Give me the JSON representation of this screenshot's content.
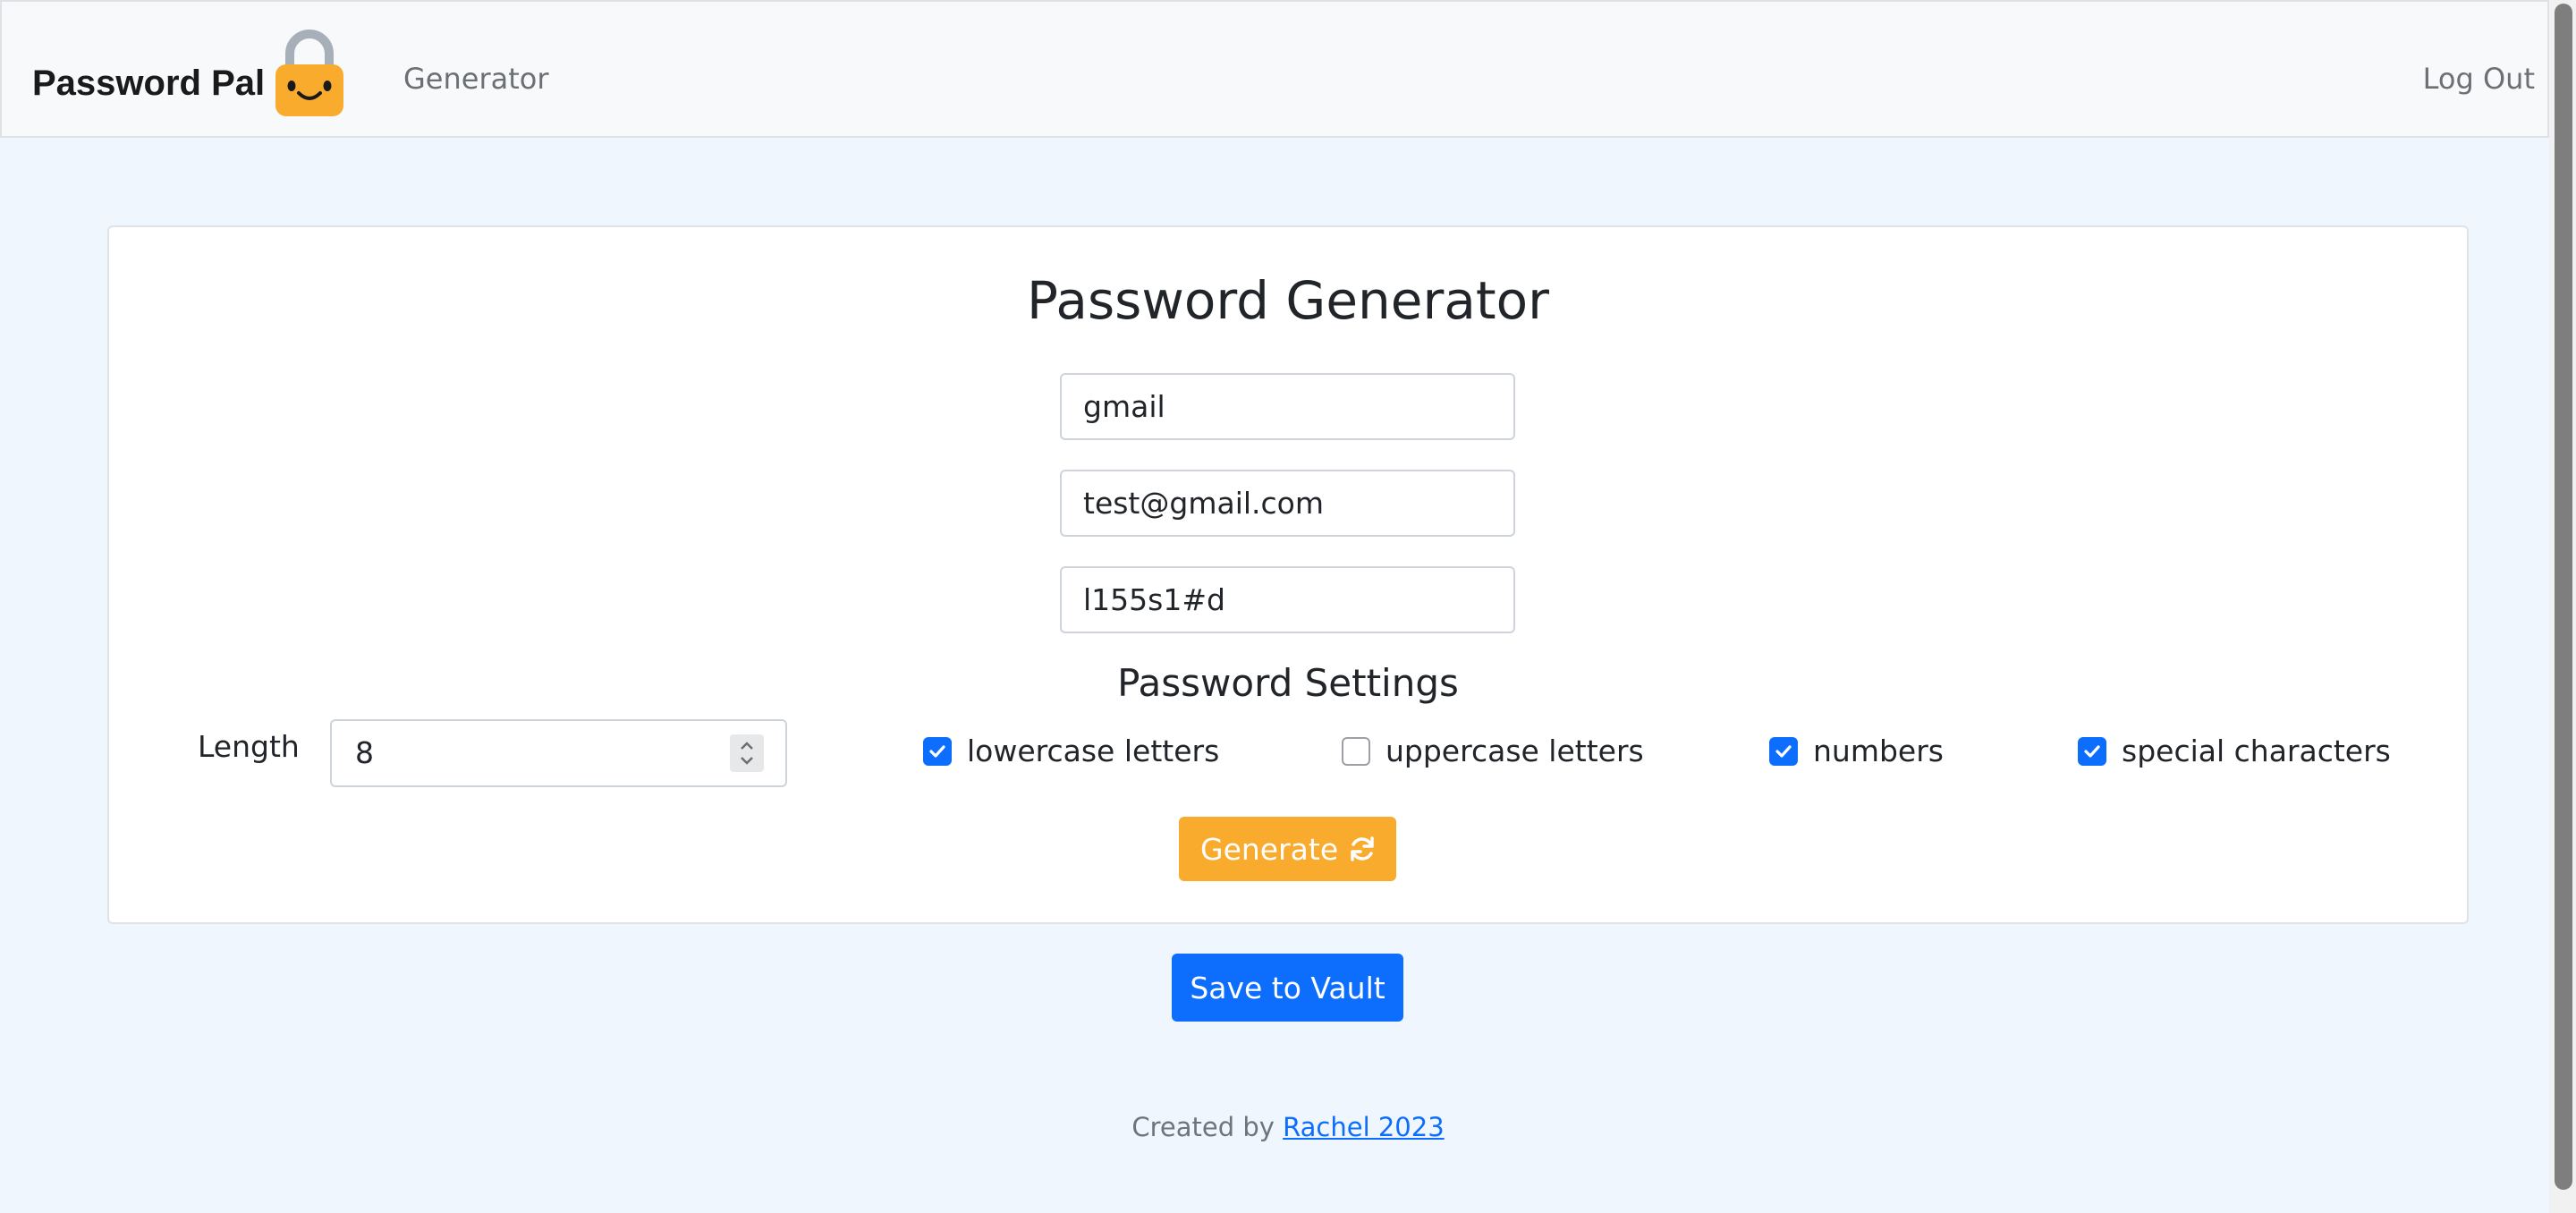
{
  "navbar": {
    "brand": "Password Pal",
    "logo_icon": "smiling-padlock-icon",
    "links": {
      "generator": "Generator",
      "logout": "Log Out"
    }
  },
  "generator": {
    "title": "Password Generator",
    "site_value": "gmail",
    "email_value": "test@gmail.com",
    "password_value": "l155s1#d",
    "settings_title": "Password Settings",
    "length_label": "Length",
    "length_value": "8",
    "options": [
      {
        "label": "lowercase letters",
        "checked": true
      },
      {
        "label": "uppercase letters",
        "checked": false
      },
      {
        "label": "numbers",
        "checked": true
      },
      {
        "label": "special characters",
        "checked": true
      }
    ],
    "generate_label": "Generate",
    "generate_icon": "sync-icon"
  },
  "save_label": "Save to Vault",
  "footer": {
    "prefix": "Created by",
    "link": "Rachel 2023"
  },
  "colors": {
    "background": "#eff6fd",
    "primary": "#0d6efd",
    "accent": "#f9ab2e",
    "lock_body": "#f9ab2e",
    "lock_shackle": "#a7b0b8"
  }
}
